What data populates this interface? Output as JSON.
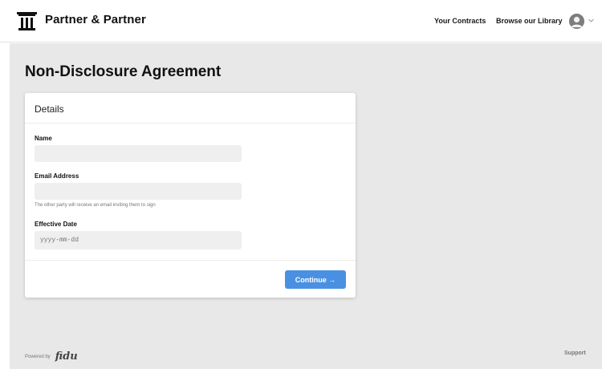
{
  "header": {
    "brand": "Partner & Partner",
    "nav": [
      "Your Contracts",
      "Browse our Library"
    ]
  },
  "page": {
    "title": "Non-Disclosure Agreement"
  },
  "form": {
    "section_title": "Details",
    "name_label": "Name",
    "name_value": "",
    "email_label": "Email Address",
    "email_value": "",
    "email_help": "The other party will receive an email inviting them to sign",
    "date_label": "Effective Date",
    "date_placeholder": "yyyy-mm-dd",
    "continue_label": "Continue →"
  },
  "footer": {
    "powered_by": "Powered by",
    "powered_logo": "fidu",
    "support": "Support"
  },
  "colors": {
    "accent": "#4a90e2",
    "background": "#e8e8e8"
  }
}
